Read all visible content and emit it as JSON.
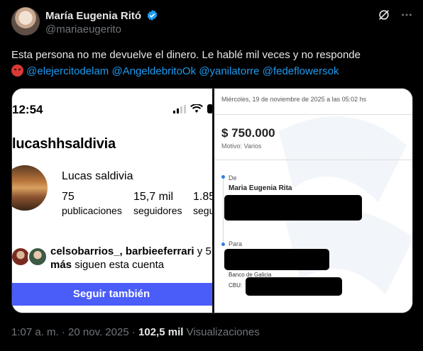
{
  "author": {
    "name": "María Eugenia Ritó",
    "handle": "@mariaeugerito"
  },
  "tweet": {
    "text": "Esta persona no me devuelve el dinero. Le hablé mil veces y no responde",
    "emoji_icon": "angry-face-icon",
    "mentions": [
      "@elejercitodelam",
      "@AngeldebritoOk",
      "@yanilatorre",
      "@fedeflowersok"
    ]
  },
  "instagram": {
    "time": "12:54",
    "username": "lucashhsaldivia",
    "full_name": "Lucas saldivia",
    "stats": [
      {
        "num": "75",
        "label": "publicaciones"
      },
      {
        "num": "15,7 mil",
        "label": "seguidores"
      },
      {
        "num": "1.85",
        "label": "segu"
      }
    ],
    "followed_by_names": "celsobarrios_, barbieeferrari",
    "followed_by_y": "y 5",
    "followed_by_more": "más",
    "followed_by_suffix": "siguen esta cuenta",
    "follow_button": "Seguir también"
  },
  "transfer": {
    "date": "Miércoles, 19 de noviembre de 2025 a las 05:02 hs",
    "amount": "$ 750.000",
    "motivo": "Motivo: Varios",
    "from_label": "De",
    "from_name": "Maria Eugenia Rita",
    "to_label": "Para",
    "bank": "Banco de Galicia",
    "cbu_label": "CBU:"
  },
  "meta": {
    "time": "1:07 a. m.",
    "separator": "·",
    "date": "20 nov. 2025",
    "views_num": "102,5 mil",
    "views_label": "Visualizaciones"
  },
  "colors": {
    "link": "#1d9bf0",
    "verified": "#1d9bf0",
    "ig_button": "#4a5df9"
  }
}
